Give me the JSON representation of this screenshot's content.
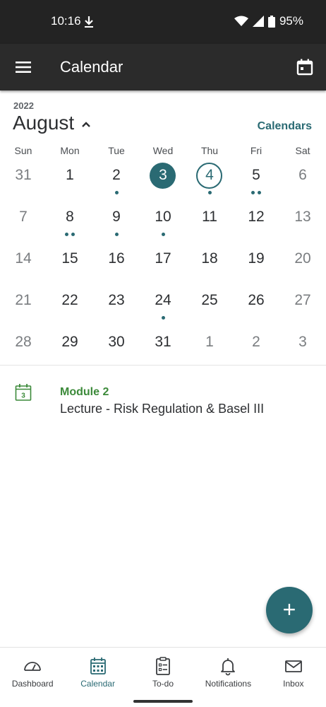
{
  "status_bar": {
    "time": "10:16",
    "battery": "95%"
  },
  "app_bar": {
    "title": "Calendar"
  },
  "header": {
    "year": "2022",
    "month": "August",
    "calendars_link": "Calendars"
  },
  "weekdays": [
    "Sun",
    "Mon",
    "Tue",
    "Wed",
    "Thu",
    "Fri",
    "Sat"
  ],
  "weeks": [
    [
      {
        "n": "31",
        "muted": true,
        "dots": 0
      },
      {
        "n": "1",
        "dots": 0
      },
      {
        "n": "2",
        "dots": 1
      },
      {
        "n": "3",
        "dots": 0,
        "state": "selected"
      },
      {
        "n": "4",
        "dots": 1,
        "state": "today"
      },
      {
        "n": "5",
        "dots": 2
      },
      {
        "n": "6",
        "muted": true,
        "dots": 0
      }
    ],
    [
      {
        "n": "7",
        "muted": true,
        "dots": 0
      },
      {
        "n": "8",
        "dots": 2
      },
      {
        "n": "9",
        "dots": 1
      },
      {
        "n": "10",
        "dots": 1
      },
      {
        "n": "11",
        "dots": 0
      },
      {
        "n": "12",
        "dots": 0
      },
      {
        "n": "13",
        "muted": true,
        "dots": 0
      }
    ],
    [
      {
        "n": "14",
        "muted": true,
        "dots": 0
      },
      {
        "n": "15",
        "dots": 0
      },
      {
        "n": "16",
        "dots": 0
      },
      {
        "n": "17",
        "dots": 0
      },
      {
        "n": "18",
        "dots": 0
      },
      {
        "n": "19",
        "dots": 0
      },
      {
        "n": "20",
        "muted": true,
        "dots": 0
      }
    ],
    [
      {
        "n": "21",
        "muted": true,
        "dots": 0
      },
      {
        "n": "22",
        "dots": 0
      },
      {
        "n": "23",
        "dots": 0
      },
      {
        "n": "24",
        "dots": 1
      },
      {
        "n": "25",
        "dots": 0
      },
      {
        "n": "26",
        "dots": 0
      },
      {
        "n": "27",
        "muted": true,
        "dots": 0
      }
    ],
    [
      {
        "n": "28",
        "muted": true,
        "dots": 0
      },
      {
        "n": "29",
        "dots": 0
      },
      {
        "n": "30",
        "dots": 0
      },
      {
        "n": "31",
        "dots": 0
      },
      {
        "n": "1",
        "muted": true,
        "dots": 0
      },
      {
        "n": "2",
        "muted": true,
        "dots": 0
      },
      {
        "n": "3",
        "muted": true,
        "dots": 0
      }
    ]
  ],
  "event": {
    "icon_day": "3",
    "module": "Module 2",
    "title": "Lecture - Risk Regulation & Basel III"
  },
  "fab": {
    "label": "+"
  },
  "bottom_nav": [
    {
      "label": "Dashboard",
      "icon": "dashboard-icon",
      "active": false
    },
    {
      "label": "Calendar",
      "icon": "calendar-icon",
      "active": true
    },
    {
      "label": "To-do",
      "icon": "todo-icon",
      "active": false
    },
    {
      "label": "Notifications",
      "icon": "bell-icon",
      "active": false
    },
    {
      "label": "Inbox",
      "icon": "inbox-icon",
      "active": false
    }
  ],
  "colors": {
    "accent": "#2a6a73",
    "module_green": "#3c8a3a",
    "app_bar": "#2b2b2b",
    "status_bar": "#232323"
  }
}
